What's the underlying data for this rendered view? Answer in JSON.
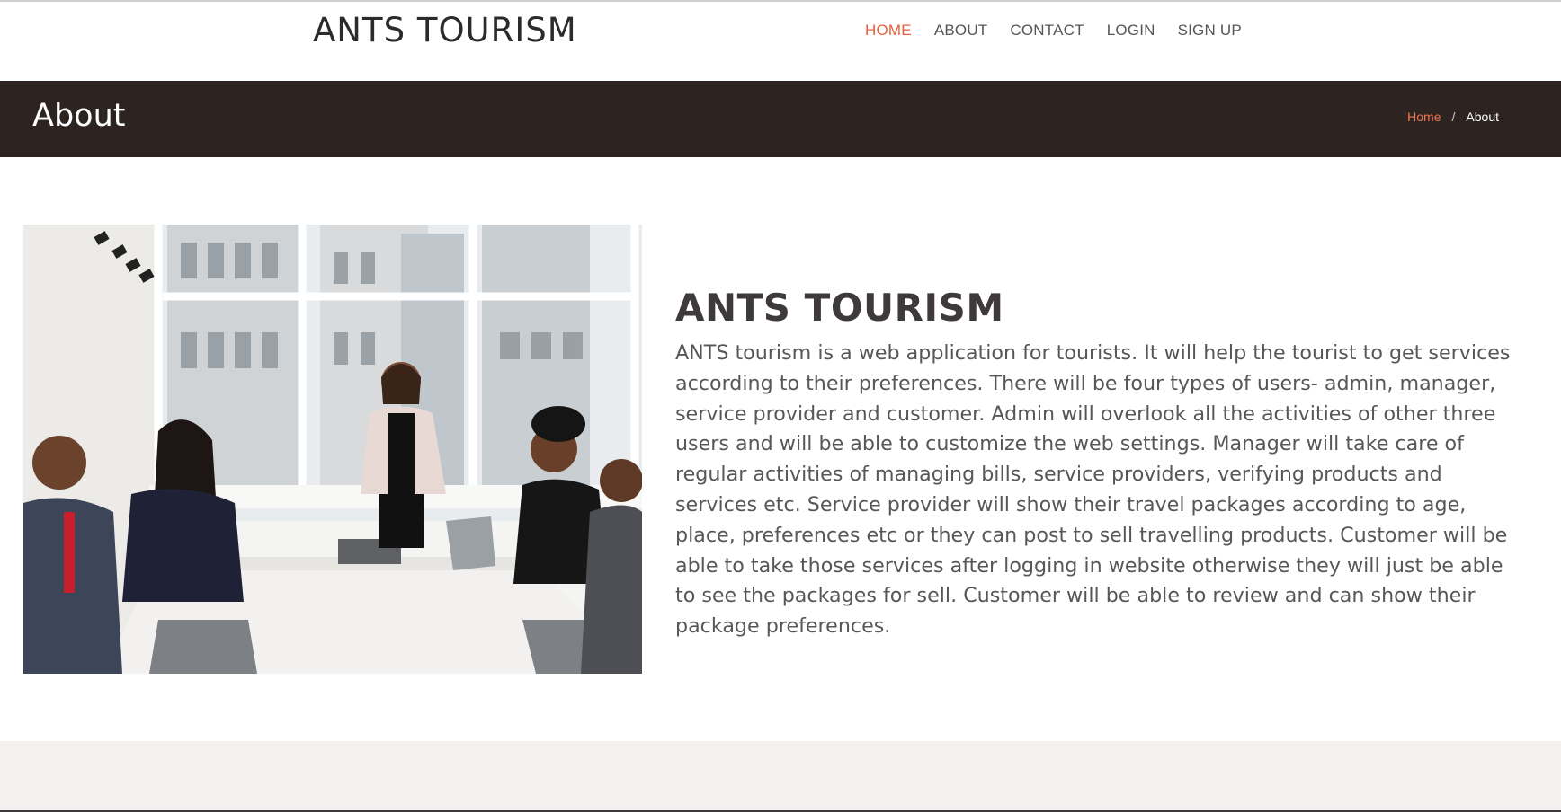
{
  "header": {
    "brand": "ANTS TOURISM",
    "nav": [
      {
        "label": "HOME",
        "active": true
      },
      {
        "label": "ABOUT",
        "active": false
      },
      {
        "label": "CONTACT",
        "active": false
      },
      {
        "label": "LOGIN",
        "active": false
      },
      {
        "label": "SIGN UP",
        "active": false
      }
    ]
  },
  "banner": {
    "title": "About",
    "breadcrumb": {
      "home": "Home",
      "separator": "/",
      "current": "About"
    }
  },
  "about": {
    "heading": "ANTS TOURISM",
    "body": "ANTS tourism is a web application for tourists. It will help the tourist to get services according to their preferences. There will be four types of users- admin, manager, service provider and customer. Admin will overlook all the activities of other three users and will be able to customize the web settings. Manager will take care of regular activities of managing bills, service providers, verifying products and services etc. Service provider will show their travel packages according to age, place, preferences etc or they can post to sell travelling products. Customer will be able to take those services after logging in website otherwise they will just be able to see the packages for sell. Customer will be able to review and can show their package preferences.",
    "image_subject": "business-meeting-photo"
  },
  "colors": {
    "accent": "#e8603c",
    "banner_bg": "#2d2422",
    "footer_bg": "#f5f1f0",
    "heading": "#3e3a39",
    "body_text": "#575757"
  }
}
